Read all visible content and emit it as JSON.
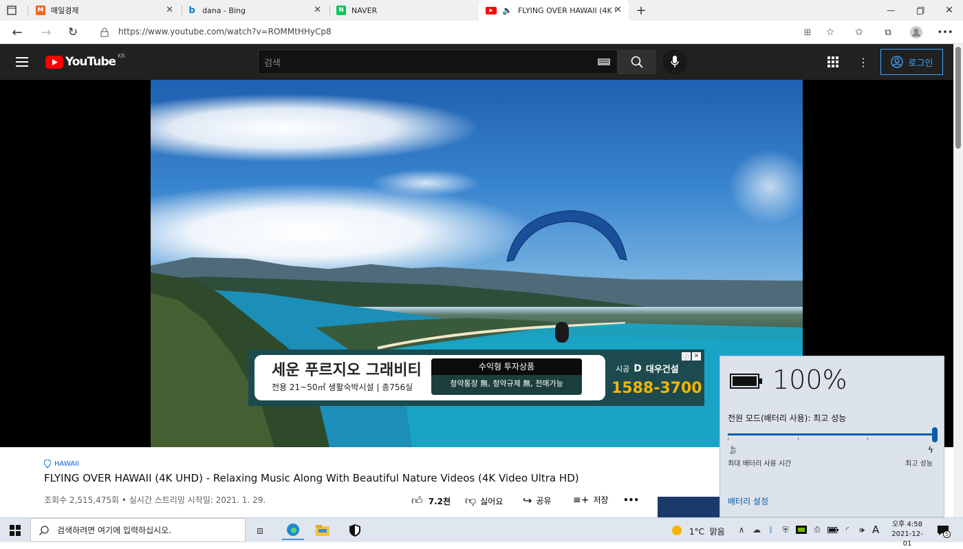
{
  "tabs": [
    {
      "label": "매일경제",
      "fav": "M",
      "fav_color": "#f26522"
    },
    {
      "label": "dana - Bing",
      "fav": "b",
      "fav_color": "#0078d4"
    },
    {
      "label": "NAVER",
      "fav": "N",
      "fav_color": "#03c75a"
    },
    {
      "label": "FLYING OVER HAWAII (4K U",
      "fav": "▶",
      "fav_color": "#ff0000"
    }
  ],
  "address": {
    "url": "https://www.youtube.com/watch?v=ROMMtHHyCp8"
  },
  "youtube": {
    "logo": "YouTube",
    "region": "KR",
    "search_placeholder": "검색",
    "login": "로그인"
  },
  "ad": {
    "title": "세운 푸르지오 그래비티",
    "subtitle": "전용 21~50㎡ 생활숙박시설 | 총756실",
    "box_title": "수익형 투자상품",
    "box_text": "청약통장 無, 청약규제 無, 전매가능",
    "builder_prefix": "시공",
    "builder": "대우건설",
    "phone": "1588-3700"
  },
  "video": {
    "tag": "HAWAII",
    "title": "FLYING OVER HAWAII (4K UHD) - Relaxing Music Along With Beautiful Nature Videos (4K Video Ultra HD)",
    "meta": "조회수 2,515,475회 • 실시간 스트리밍 시작일: 2021. 1. 29.",
    "likes": "7.2천",
    "dislike": "싫어요",
    "share": "공유",
    "save": "저장",
    "more": "•••"
  },
  "battery": {
    "percent": "100%",
    "mode": "전원 모드(배터리 사용): 최고 성능",
    "left_label": "최대 배터리 사용 시간",
    "right_label": "최고 성능",
    "settings": "배터리 설정",
    "slider_level": 1.0
  },
  "taskbar": {
    "search": "검색하려면 여기에 입력하십시오.",
    "weather": "1°C  맑음",
    "ime": "A",
    "time": "오후 4:58",
    "date": "2021-12-01",
    "notif_count": "5"
  }
}
